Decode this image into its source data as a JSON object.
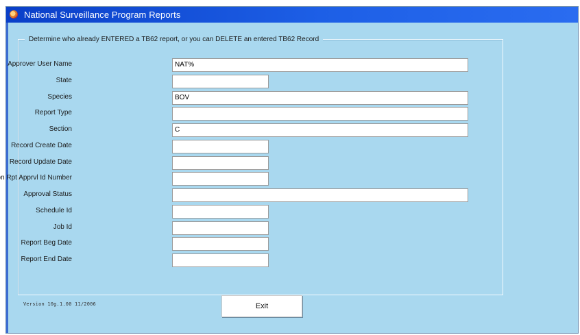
{
  "window": {
    "title": "National Surveillance Program Reports"
  },
  "frame": {
    "legend": "Determine who already ENTERED a TB62 report, or you can DELETE an entered TB62 Record"
  },
  "form": {
    "fields": [
      {
        "label": "Approver User Name",
        "value": "NAT%"
      },
      {
        "label": "State",
        "value": ""
      },
      {
        "label": "Species",
        "value": "BOV"
      },
      {
        "label": "Report Type",
        "value": ""
      },
      {
        "label": "Section",
        "value": "C"
      },
      {
        "label": "Record Create Date",
        "value": ""
      },
      {
        "label": "Record Update Date",
        "value": ""
      },
      {
        "label": "Mon Rpt Apprvl Id Number",
        "value": ""
      },
      {
        "label": "Approval Status",
        "value": ""
      },
      {
        "label": "Schedule Id",
        "value": ""
      },
      {
        "label": "Job Id",
        "value": ""
      },
      {
        "label": "Report Beg Date",
        "value": ""
      },
      {
        "label": "Report End Date",
        "value": ""
      }
    ]
  },
  "footer": {
    "version": "Version 10g.1.00 11/2006",
    "exit_label": "Exit"
  },
  "colors": {
    "window_bg": "#a9d8ef",
    "titlebar": "#1d5fe6"
  },
  "icons": {
    "app": "app-icon"
  }
}
